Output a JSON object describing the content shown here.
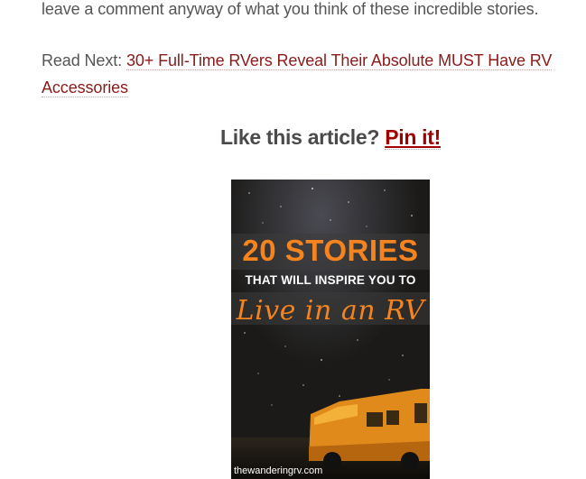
{
  "article": {
    "top_line": "leave a comment anyway of what you think of these incredible stories.",
    "read_next_label": "Read Next: ",
    "read_next_link": "30+ Full-Time RVers Reveal Their Absolute MUST Have RV Accessories"
  },
  "pin_cta": {
    "prompt": "Like this article? ",
    "link": "Pin it!"
  },
  "pin_image": {
    "headline": "20 STORIES",
    "subline": "THAT WILL INSPIRE YOU TO",
    "script": "Live in an RV",
    "site": "thewanderingrv.com"
  },
  "colors": {
    "link": "#8b1a1a",
    "pin_link": "#a00000",
    "accent_orange": "#f5841f"
  }
}
